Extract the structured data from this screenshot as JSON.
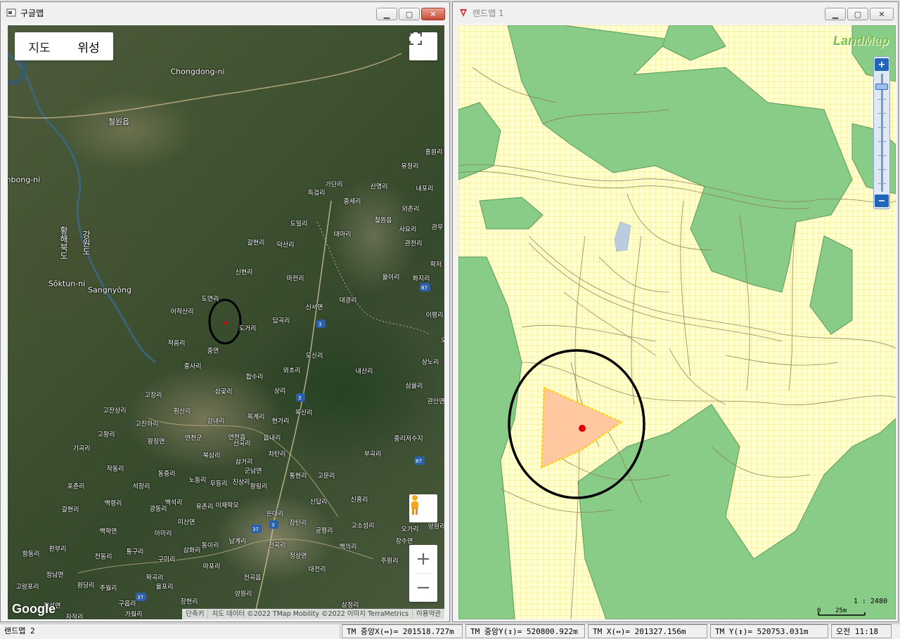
{
  "left_window": {
    "title": "구글맵",
    "map_type": {
      "map": "지도",
      "satellite": "위성"
    },
    "zoom_in": "+",
    "zoom_out": "−",
    "google_logo": "Google",
    "attribution": [
      "단축키",
      "지도 데이터 ©2022 TMap Mobility ©2022 이미지 TerraMetrics",
      "이용약관"
    ],
    "place_labels": [
      "Chongdong-ni",
      "철원읍",
      "mbong-ni",
      "Sŏktun-ni",
      "Sangnyŏng",
      "황해북도",
      "강원도",
      "홍원리",
      "유정리",
      "가단리",
      "산명리",
      "내포리",
      "득검리",
      "중세리",
      "외촌리",
      "도밀리",
      "철원읍",
      "사요리",
      "관우",
      "대마리",
      "갈현리",
      "덕산리",
      "관전리",
      "신현리",
      "학저",
      "마전리",
      "율이리",
      "화지리",
      "도연리",
      "대광리",
      "어적산리",
      "신서면",
      "이평리",
      "도거리",
      "답곡리",
      "적음리",
      "중면",
      "도신리",
      "오",
      "내산리",
      "상노리",
      "중사리",
      "와초리",
      "합수리",
      "상리",
      "삼율리",
      "고장리",
      "삼곶리",
      "관인면",
      "고잔상리",
      "횡산리",
      "옥산리",
      "고잔하리",
      "강내리",
      "옥계리",
      "현가리",
      "고왕리",
      "왕징면",
      "연천군",
      "읍내리",
      "연천읍",
      "중리저수지",
      "기곡리",
      "선곡리",
      "차탄리",
      "부곡리",
      "작동리",
      "북삼리",
      "삼거리",
      "동중리",
      "군남면",
      "통현리",
      "고문리",
      "포춘리",
      "석장리",
      "노동리",
      "무등리",
      "진상리",
      "왕림리",
      "백령리",
      "백석리",
      "유촌리",
      "이재학모",
      "신답리",
      "신흥리",
      "갈현리",
      "광동리",
      "미산면",
      "은대리",
      "백학면",
      "아미리",
      "고소성리",
      "오가리",
      "장탄리",
      "궁평리",
      "양원리",
      "항동리",
      "판부리",
      "동이리",
      "남계리",
      "전곡리",
      "장수면",
      "전동리",
      "통구리",
      "삼화리",
      "구미리",
      "정상면",
      "백의리",
      "주원리",
      "정남면",
      "마포리",
      "대전리",
      "고랑포리",
      "원당리",
      "학곡리",
      "율포리",
      "전곡읍",
      "주월리",
      "양원리",
      "구읍리",
      "가월리",
      "장현리",
      "삼정리",
      "적성면",
      "자작리"
    ],
    "road_numbers": [
      "3",
      "3",
      "3",
      "37",
      "37",
      "87",
      "87"
    ]
  },
  "right_window": {
    "title": "랜드맵 1",
    "logo": "LandMap",
    "zoom_plus": "+",
    "zoom_minus": "−",
    "scale_ratio": "1 : 2480",
    "scale_bar_start": "0",
    "scale_bar_end": "25m"
  },
  "statusbar": {
    "app": "랜드맵 2",
    "tm_center_x": "TM 중앙X(↔)= 201518.727m",
    "tm_center_y": "TM 중앙Y(↕)= 520800.922m",
    "tm_x": "TM X(↔)= 201327.156m",
    "tm_y": "TM Y(↕)= 520753.031m",
    "time": "오전 11:18"
  },
  "colors": {
    "parcel_yellow": "#ffffc8",
    "grid_yellow": "#f2e07a",
    "forest_green": "#88cc88",
    "highlight_orange": "#ffc8a0",
    "marker_red": "#e00000"
  }
}
